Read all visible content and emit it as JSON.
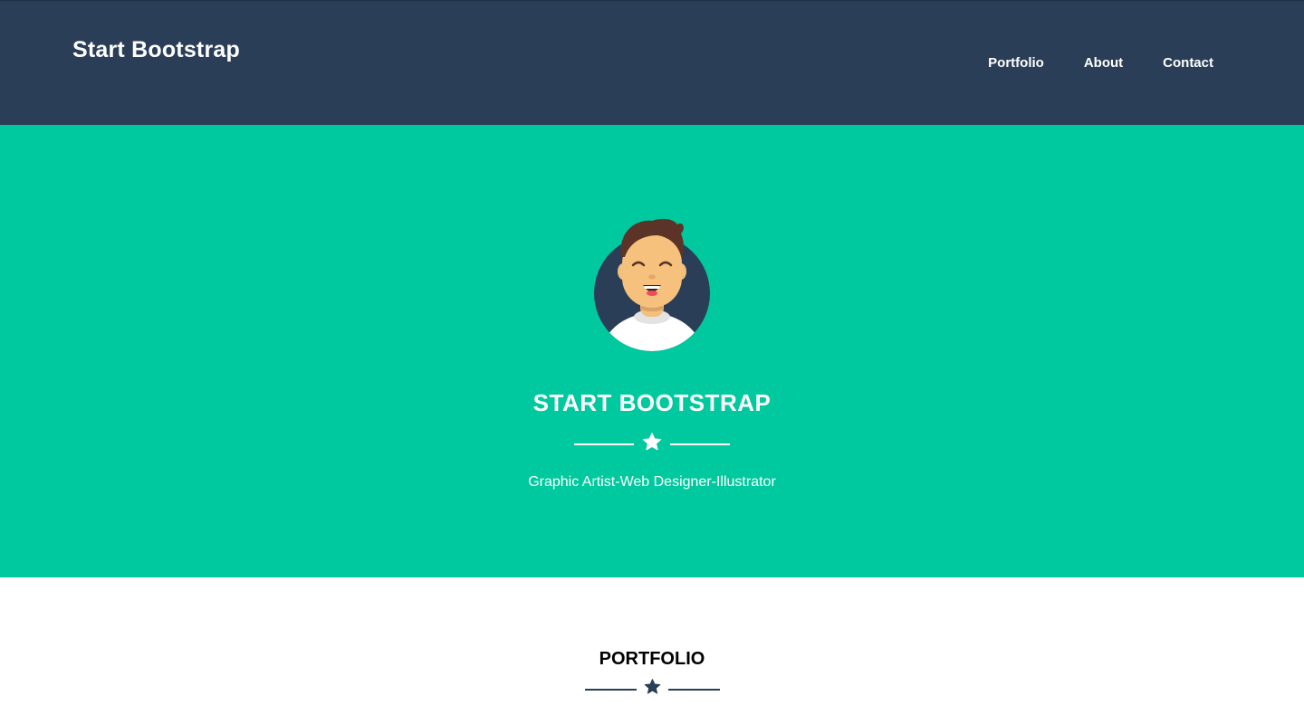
{
  "navbar": {
    "brand": "Start Bootstrap",
    "links": [
      {
        "label": "Portfolio"
      },
      {
        "label": "About"
      },
      {
        "label": "Contact"
      }
    ]
  },
  "hero": {
    "title": "START BOOTSTRAP",
    "subtitle": "Graphic Artist-Web Designer-Illustrator",
    "divider_icon": "star-icon"
  },
  "portfolio": {
    "title": "PORTFOLIO",
    "divider_icon": "star-icon"
  },
  "colors": {
    "navbar_bg": "#2a3e57",
    "hero_bg": "#00c99f",
    "text_light": "#ffffff",
    "section_bg": "#ffffff"
  }
}
